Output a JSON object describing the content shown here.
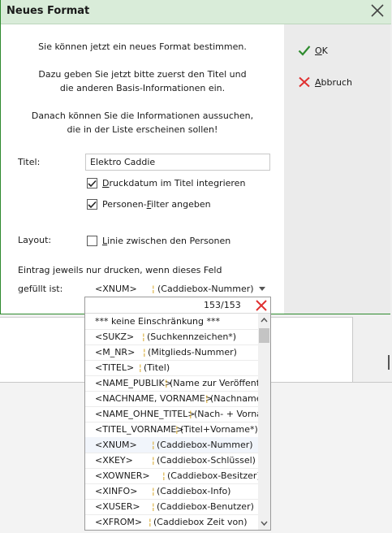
{
  "dialog": {
    "title": "Neues Format",
    "intro": [
      "Sie können jetzt ein neues Format bestimmen.",
      "Dazu geben Sie jetzt bitte zuerst den Titel und",
      "die anderen Basis-Informationen ein.",
      "Danach können Sie die Informationen aussuchen,",
      "die in der Liste erscheinen sollen!"
    ],
    "ok": {
      "pre": "",
      "key": "O",
      "post": "K"
    },
    "cancel": {
      "pre": "",
      "key": "A",
      "post": "bbruch"
    },
    "colors": {
      "accent_green": "#2e8b2e",
      "cancel_red": "#e03030",
      "titlebar": "#d9ecd9"
    }
  },
  "form": {
    "titel_label": "Titel:",
    "titel_value": "Elektro Caddie",
    "cb1": {
      "pre": "",
      "key": "D",
      "post": "ruckdatum im Titel integrieren",
      "checked": true
    },
    "cb2": {
      "pre": "Personen-",
      "key": "F",
      "post": "ilter angeben",
      "checked": true
    },
    "layout_label": "Layout:",
    "cb3": {
      "pre": "",
      "key": "L",
      "post": "inie zwischen den Personen",
      "checked": false
    },
    "filter_line1": "Eintrag jeweils nur drucken, wenn dieses Feld",
    "filter_line2": "gefüllt ist:",
    "combo": {
      "code": "<XNUM>",
      "pipe": "¦",
      "desc": "(Caddiebox-Nummer)"
    }
  },
  "dropdown": {
    "count": "153/153",
    "items": [
      {
        "text": "*** keine Einschränkung ***"
      },
      {
        "code": "<SUKZ>",
        "desc": "(Suchkennzeichen*)"
      },
      {
        "code": "<M_NR>",
        "desc": "(Mitglieds-Nummer)"
      },
      {
        "code": "<TITEL>",
        "desc": "(Titel)"
      },
      {
        "code": "<NAME_PUBLIK>",
        "desc": "(Name zur Veröffentl"
      },
      {
        "code": "<NACHNAME, VORNAME>",
        "desc": "(Nachname"
      },
      {
        "code": "<NAME_OHNE_TITEL>",
        "desc": "(Nach- + Vorna"
      },
      {
        "code": "<TITEL_VORNAME>",
        "desc": "(Titel+Vorname*)"
      },
      {
        "code": "<XNUM>",
        "desc": "(Caddiebox-Nummer)",
        "selected": true
      },
      {
        "code": "<XKEY>",
        "desc": "(Caddiebox-Schlüssel)"
      },
      {
        "code": "<XOWNER>",
        "desc": "(Caddiebox-Besitzer)"
      },
      {
        "code": "<XINFO>",
        "desc": "(Caddiebox-Info)"
      },
      {
        "code": "<XUSER>",
        "desc": "(Caddiebox-Benutzer)"
      },
      {
        "code": "<XFROM>",
        "desc": "(Caddiebox Zeit von)"
      }
    ],
    "pipe": "¦"
  }
}
